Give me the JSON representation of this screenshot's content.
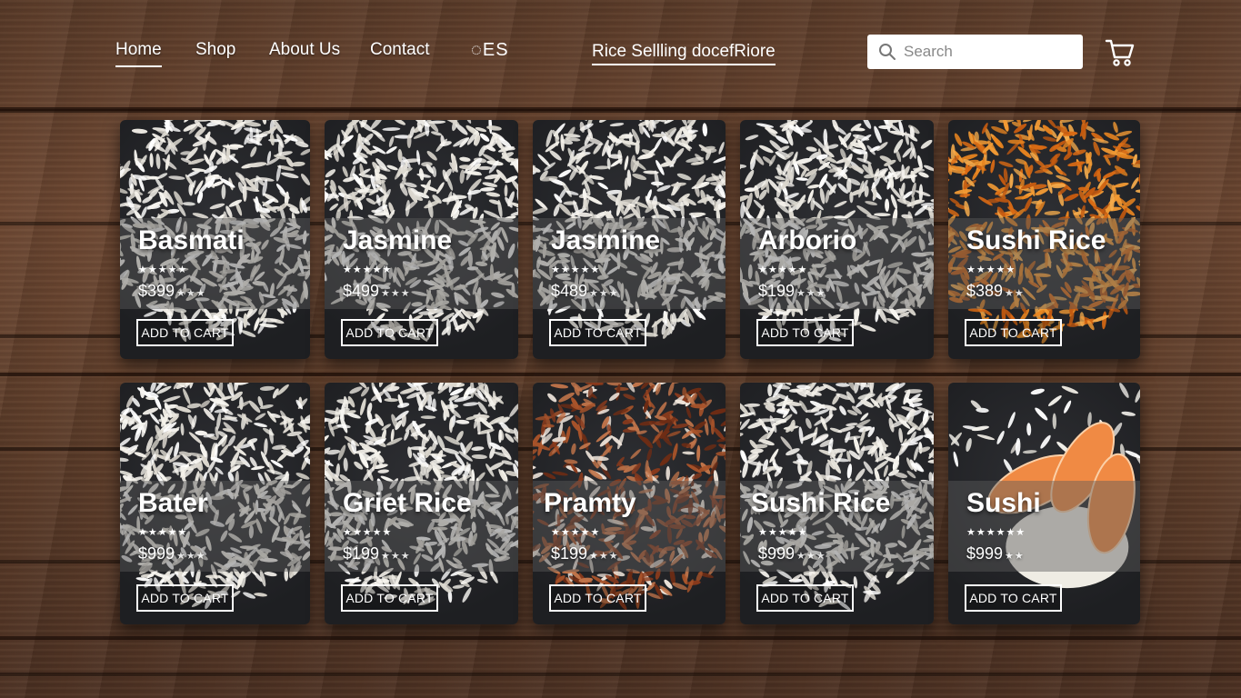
{
  "nav": {
    "links": [
      "Home",
      "Shop",
      "About Us",
      "Contact"
    ],
    "logo_mark": "◌ES",
    "brand": "Rice Sellling docefRiore",
    "search_placeholder": "Search"
  },
  "colors": {
    "wood": "#5a3b29",
    "card": "#1e1f22",
    "band": "#5a5a5a",
    "orange_rice": "#e07a1f",
    "brown_rice": "#8a3a1c",
    "salmon": "#f08a44"
  },
  "products": [
    {
      "name": "Basmati",
      "stars": "★★★★★",
      "price": "$399",
      "price_stars": "★★★",
      "button": "ADD TO CART"
    },
    {
      "name": "Jasmine",
      "stars": "★★★★★",
      "price": "$499",
      "price_stars": "★★★",
      "button": "ADD TO CART"
    },
    {
      "name": "Jasmine",
      "stars": "★★★★★",
      "price": "$489",
      "price_stars": "★★★",
      "button": "ADD TO CART"
    },
    {
      "name": "Arborio",
      "stars": "★★★★★",
      "price": "$199",
      "price_stars": "★★★",
      "button": "ADD TO CART"
    },
    {
      "name": "Sushi Rice",
      "stars": "★★★★★",
      "price": "$389",
      "price_stars": "★★",
      "button": "ADD TO CART"
    },
    {
      "name": "Bater",
      "stars": "★★★★★",
      "price": "$999",
      "price_stars": "★★★",
      "button": "ADD TO CART"
    },
    {
      "name": "Griet Rice",
      "stars": "★★★★★",
      "price": "$199",
      "price_stars": "★★★",
      "button": "ADD TO CART"
    },
    {
      "name": "Pramty",
      "stars": "★★★★★",
      "price": "$199",
      "price_stars": "★★★",
      "button": "ADD TO CART"
    },
    {
      "name": "Sushi Rice",
      "stars": "★★★★★",
      "price": "$999",
      "price_stars": "★★★",
      "button": "ADD TO CART"
    },
    {
      "name": "Sushi",
      "stars": "★★★★★★",
      "price": "$999",
      "price_stars": "★★",
      "button": "ADD TO CART"
    }
  ]
}
